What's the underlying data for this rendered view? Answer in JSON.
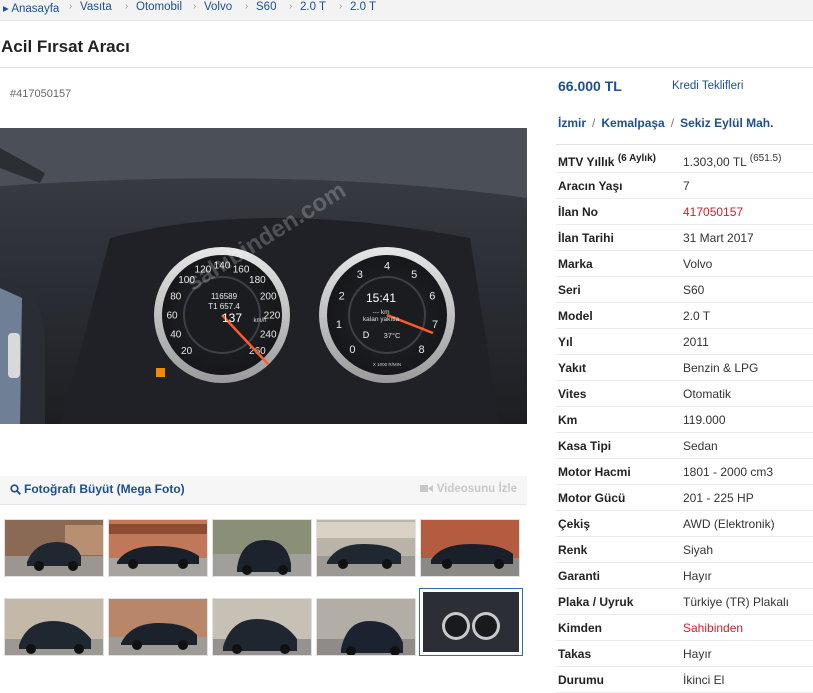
{
  "breadcrumb": [
    "Anasayfa",
    "Vasıta",
    "Otomobil",
    "Volvo",
    "S60",
    "2.0 T",
    "2.0 T"
  ],
  "listing": {
    "title": "Acil Fırsat Aracı",
    "number": "#417050157",
    "price": "66.000 TL",
    "credit_link": "Kredi Teklifleri",
    "location": [
      "İzmir",
      "Kemalpaşa",
      "Sekiz Eylül Mah."
    ]
  },
  "photo_tools": {
    "enlarge_label": "Fotoğrafı Büyüt (Mega Foto)",
    "video_label": "Videosunu İzle"
  },
  "photo": {
    "watermark": "sahibinden.com",
    "speedo_big": "137",
    "speedo_unit": "km/h",
    "odometer": "116589",
    "trip": "T1 657.4",
    "clock": "15:41",
    "range_label": "kalan yakıtla",
    "range_value": "--- km",
    "gear": "D",
    "temp": "37°C",
    "speed_ticks": [
      "20",
      "40",
      "60",
      "80",
      "100",
      "120",
      "140",
      "160",
      "180",
      "200",
      "220",
      "240",
      "260"
    ],
    "rpm_ticks": [
      "0",
      "1",
      "2",
      "3",
      "4",
      "5",
      "6",
      "7",
      "8"
    ],
    "rpm_unit": "X 1000 R/MIN"
  },
  "specs": [
    {
      "label": "MTV Yıllık",
      "label_sup": "(6 Aylık)",
      "value": "1.303,00 TL",
      "value_sup": "(651.5)"
    },
    {
      "label": "Aracın Yaşı",
      "value": "7"
    },
    {
      "label": "İlan No",
      "value": "417050157",
      "highlight": true
    },
    {
      "label": "İlan Tarihi",
      "value": "31 Mart 2017"
    },
    {
      "label": "Marka",
      "value": "Volvo"
    },
    {
      "label": "Seri",
      "value": "S60"
    },
    {
      "label": "Model",
      "value": "2.0 T"
    },
    {
      "label": "Yıl",
      "value": "2011"
    },
    {
      "label": "Yakıt",
      "value": "Benzin & LPG"
    },
    {
      "label": "Vites",
      "value": "Otomatik"
    },
    {
      "label": "Km",
      "value": "119.000"
    },
    {
      "label": "Kasa Tipi",
      "value": "Sedan"
    },
    {
      "label": "Motor Hacmi",
      "value": "1801 - 2000 cm3"
    },
    {
      "label": "Motor Gücü",
      "value": "201 - 225 HP"
    },
    {
      "label": "Çekiş",
      "value": "AWD (Elektronik)"
    },
    {
      "label": "Renk",
      "value": "Siyah"
    },
    {
      "label": "Garanti",
      "value": "Hayır"
    },
    {
      "label": "Plaka / Uyruk",
      "value": "Türkiye (TR) Plakalı"
    },
    {
      "label": "Kimden",
      "value": "Sahibinden",
      "highlight": true
    },
    {
      "label": "Takas",
      "value": "Hayır"
    },
    {
      "label": "Durumu",
      "value": "İkinci El"
    }
  ],
  "colors": {
    "link": "#1d4f91",
    "highlight": "#c8232e"
  }
}
